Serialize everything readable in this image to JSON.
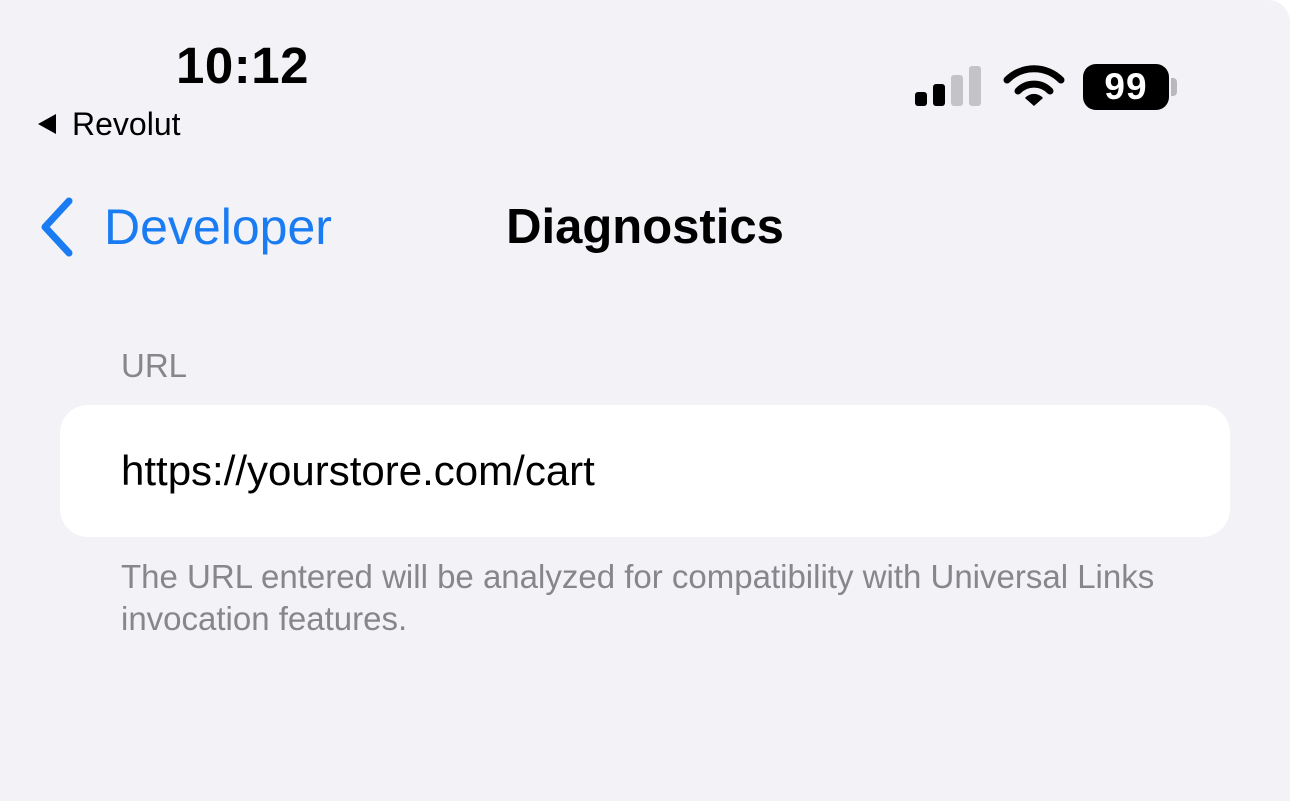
{
  "status_bar": {
    "time": "10:12",
    "back_app_label": "Revolut",
    "battery_level": "99",
    "signal_bars_active": 2,
    "signal_bars_total": 4,
    "signal_icon": "cellular-signal-icon",
    "wifi_icon": "wifi-icon",
    "battery_icon": "battery-icon"
  },
  "nav": {
    "back_label": "Developer",
    "back_icon": "chevron-left-icon",
    "title": "Diagnostics"
  },
  "form": {
    "section_header": "URL",
    "url_value": "https://yourstore.com/cart",
    "footer_text": "The URL entered will be analyzed for compatibility with Universal Links invocation features."
  },
  "colors": {
    "background": "#f2f2f7",
    "accent": "#1a7cf2",
    "secondary_text": "#86868b",
    "cell_background": "#ffffff"
  }
}
